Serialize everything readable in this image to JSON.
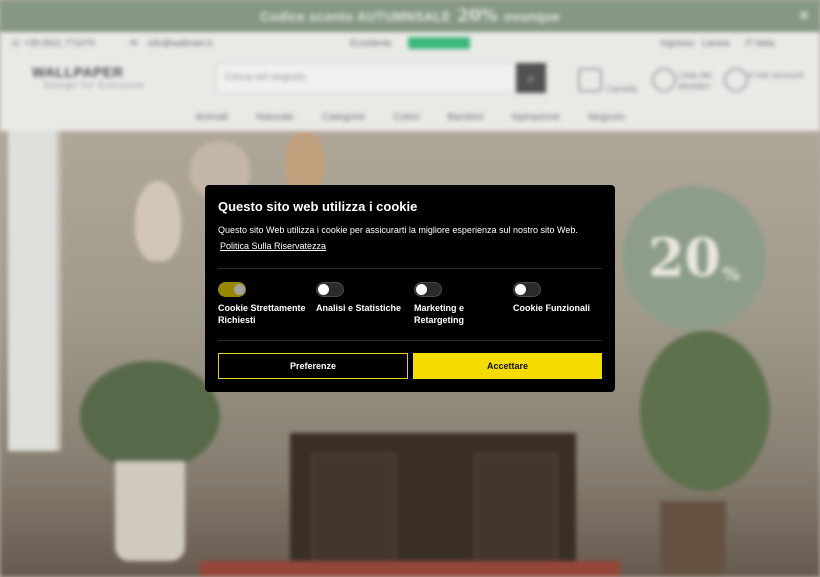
{
  "promo": {
    "text_before": "Codice sconto AUTUMNSALE",
    "discount": "20%",
    "text_after": "ovunque",
    "close_icon": "close-icon"
  },
  "topbar": {
    "phone": "+39 0521 771079",
    "email": "info@wallmart.it",
    "review_label": "Eccellente",
    "right_1": "Ingresso",
    "right_2": "Lavora",
    "language": "IT Italia"
  },
  "header": {
    "logo": "WALLPAPER",
    "tagline": "Design for Everyone",
    "search_placeholder": "Cerca nel negozio",
    "cart_label": "Carrello",
    "wishlist_label": "Lista dei desideri",
    "account_label": "Il mio account"
  },
  "nav": [
    "Animali",
    "Naturale",
    "Categorie",
    "Colori",
    "Bambini",
    "Ispirazione",
    "Negozio"
  ],
  "hero": {
    "discount": "20",
    "percent": "%"
  },
  "cookie_modal": {
    "title": "Questo sito web utilizza i cookie",
    "description": "Questo sito Web utilizza i cookie per assicurarti la migliore esperienza sul nostro sito Web.",
    "policy_link": "Politica Sulla Riservatezza",
    "options": [
      {
        "label_line1": "Cookie Strettamente",
        "label_line2": "Richiesti",
        "enabled": true
      },
      {
        "label_line1": "Analisi e Statistiche",
        "label_line2": "",
        "enabled": false
      },
      {
        "label_line1": "Marketing e",
        "label_line2": "Retargeting",
        "enabled": false
      },
      {
        "label_line1": "Cookie Funzionali",
        "label_line2": "",
        "enabled": false
      }
    ],
    "preferences_button": "Preferenze",
    "accept_button": "Accettare",
    "accent_color": "#f4dc00"
  }
}
